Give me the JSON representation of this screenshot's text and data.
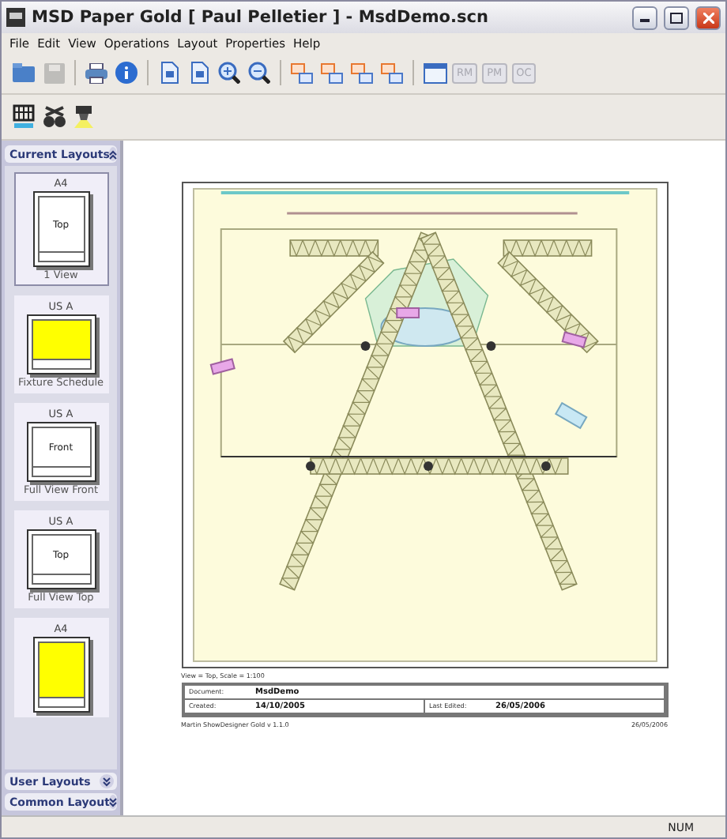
{
  "window": {
    "title": "MSD Paper Gold [  Paul Pelletier ] - MsdDemo.scn"
  },
  "menu": [
    "File",
    "Edit",
    "View",
    "Operations",
    "Layout",
    "Properties",
    "Help"
  ],
  "toolbar": [
    {
      "kind": "open",
      "disabled": false
    },
    {
      "kind": "save",
      "disabled": true
    },
    {
      "kind": "sep"
    },
    {
      "kind": "print",
      "disabled": false
    },
    {
      "kind": "info",
      "disabled": false
    },
    {
      "kind": "sep"
    },
    {
      "kind": "page11",
      "disabled": false
    },
    {
      "kind": "pagef",
      "disabled": false
    },
    {
      "kind": "zoomin",
      "disabled": false
    },
    {
      "kind": "zoomout",
      "disabled": false
    },
    {
      "kind": "sep"
    },
    {
      "kind": "layers",
      "disabled": false
    },
    {
      "kind": "layers",
      "disabled": false
    },
    {
      "kind": "layers",
      "disabled": false
    },
    {
      "kind": "layers",
      "disabled": false
    },
    {
      "kind": "sep"
    },
    {
      "kind": "window",
      "disabled": false
    },
    {
      "kind": "text",
      "label": "RM",
      "disabled": true
    },
    {
      "kind": "text",
      "label": "PM",
      "disabled": true
    },
    {
      "kind": "text",
      "label": "OC",
      "disabled": true
    }
  ],
  "toolbar2": [
    {
      "kind": "truss"
    },
    {
      "kind": "fixtures"
    },
    {
      "kind": "light"
    }
  ],
  "sidebar": {
    "sections": [
      {
        "title": "Current Layouts",
        "expanded": true
      },
      {
        "title": "User Layouts",
        "expanded": false
      },
      {
        "title": "Common Layout",
        "expanded": false
      }
    ],
    "layouts": [
      {
        "paper": "A4",
        "kind": "view",
        "thumb_label": "Top",
        "caption": "1 View",
        "selected": true
      },
      {
        "paper": "US A",
        "kind": "schedule",
        "caption": "Fixture Schedule",
        "selected": false
      },
      {
        "paper": "US A",
        "kind": "view",
        "thumb_label": "Front",
        "caption": "Full View Front",
        "selected": false
      },
      {
        "paper": "US A",
        "kind": "view",
        "thumb_label": "Top",
        "caption": "Full View Top",
        "selected": false
      },
      {
        "paper": "A4",
        "kind": "schedule",
        "selected": false
      }
    ]
  },
  "page": {
    "view_caption": "View = Top, Scale = 1:100",
    "title_block": [
      {
        "label": "Document:",
        "value": "MsdDemo"
      },
      {
        "label": "Created:",
        "value": "14/10/2005"
      },
      {
        "label": "Last Edited:",
        "value": "26/05/2006"
      }
    ],
    "footer_left": "Martin ShowDesigner Gold   v 1.1.0",
    "footer_right": "26/05/2006"
  },
  "status_bar": {
    "indicator": "NUM"
  }
}
